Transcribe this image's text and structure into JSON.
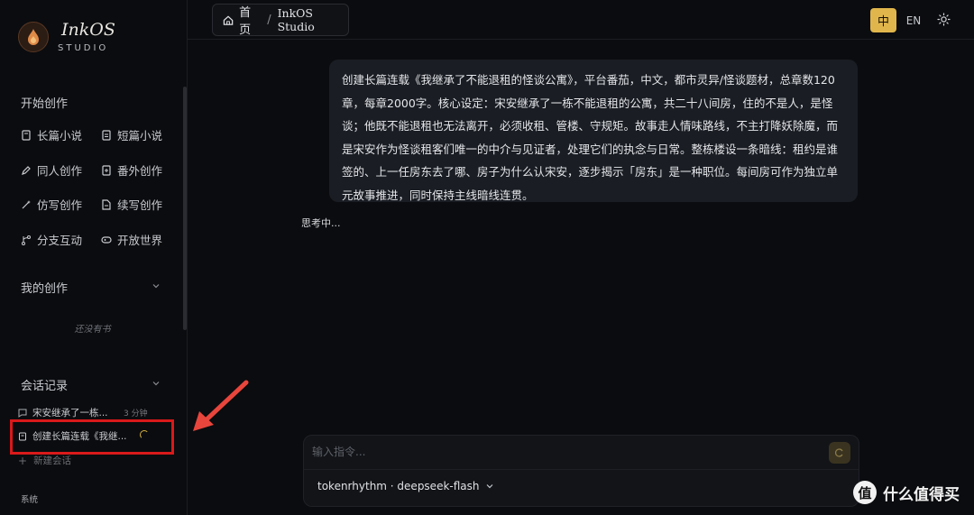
{
  "brand": {
    "name": "InkOS",
    "sub": "STUDIO"
  },
  "sidebar": {
    "create_title": "开始创作",
    "create_items": [
      {
        "label": "长篇小说",
        "icon": "book-icon"
      },
      {
        "label": "短篇小说",
        "icon": "short-story-icon"
      },
      {
        "label": "同人创作",
        "icon": "pen-icon"
      },
      {
        "label": "番外创作",
        "icon": "extra-icon"
      },
      {
        "label": "仿写创作",
        "icon": "wand-icon"
      },
      {
        "label": "续写创作",
        "icon": "continue-file-icon"
      },
      {
        "label": "分支互动",
        "icon": "branch-icon"
      },
      {
        "label": "开放世界",
        "icon": "gamepad-icon"
      }
    ],
    "works_title": "我的创作",
    "works_empty": "还没有书",
    "sessions_title": "会话记录",
    "sessions": [
      {
        "title": "宋安继承了一栋...",
        "time": "3 分钟",
        "icon": "chat-icon"
      },
      {
        "title": "创建长篇连载《我继...",
        "icon": "book-icon",
        "loading": true
      }
    ],
    "new_session": "新建会话",
    "system_label": "系统"
  },
  "topbar": {
    "home": "首页",
    "separator": "/",
    "current": "InkOS Studio",
    "lang_zh": "中",
    "lang_en": "EN",
    "accent": "#e0b64c"
  },
  "chat": {
    "user_message": "创建长篇连载《我继承了不能退租的怪谈公寓》，平台番茄，中文，都市灵异/怪谈题材，总章数120章，每章2000字。核心设定：宋安继承了一栋不能退租的公寓，共二十八间房，住的不是人，是怪谈；他既不能退租也无法离开，必须收租、管楼、守规矩。故事走人情味路线，不主打降妖除魔，而是宋安作为怪谈租客们唯一的中介与见证者，处理它们的执念与日常。整栋楼设一条暗线：租约是谁签的、上一任房东去了哪、房子为什么认宋安，逐步揭示「房东」是一种职位。每间房可作为独立单元故事推进，同时保持主线暗线连贯。",
    "status": "思考中..."
  },
  "composer": {
    "placeholder": "输入指令...",
    "model": "tokenrhythm · deepseek-flash"
  },
  "watermark": {
    "logo": "值",
    "text": "什么值得买"
  }
}
